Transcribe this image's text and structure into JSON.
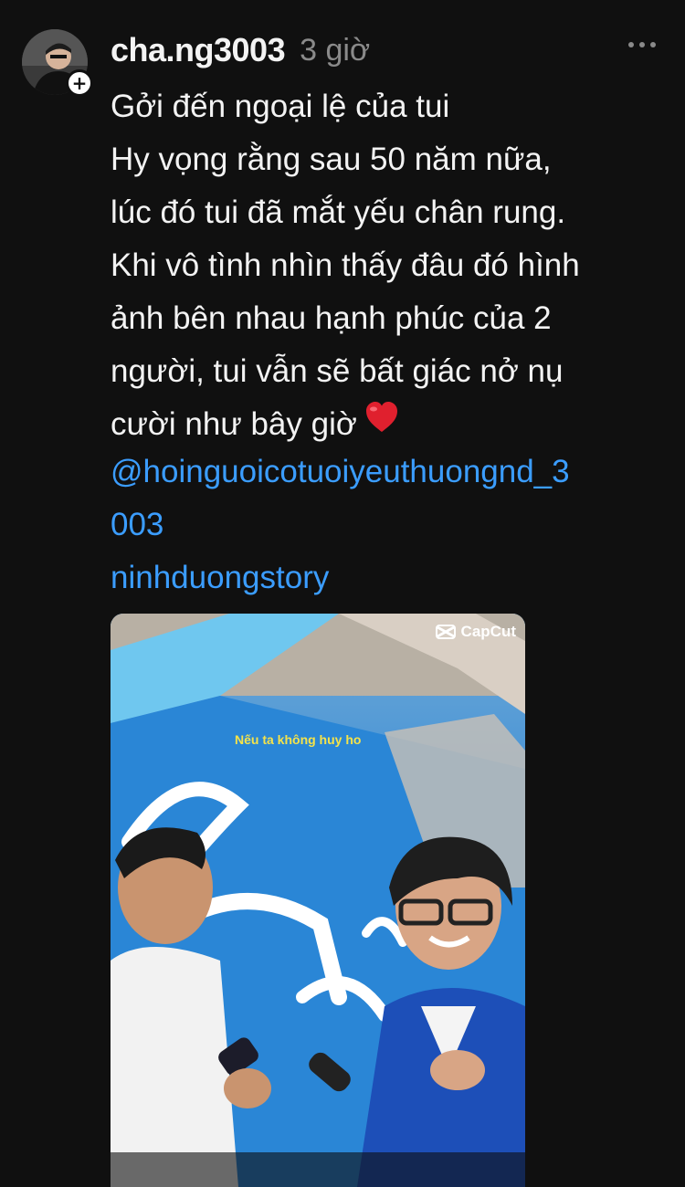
{
  "post": {
    "username": "cha.ng3003",
    "time": "3 giờ",
    "avatar": {
      "icon": "profile-photo",
      "badge": "+"
    },
    "more_icon": "more-dots-icon",
    "text_lines": [
      "Gởi đến ngoại lệ của tui",
      "Hy vọng rằng sau 50 năm nữa,",
      "lúc đó tui đã mắt yếu chân rung.",
      "Khi vô tình nhìn thấy đâu đó hình",
      "ảnh bên nhau hạnh phúc của 2",
      "người, tui vẫn sẽ bất giác nở nụ",
      "cười như bây giờ"
    ],
    "heart_icon": "red-heart-emoji",
    "links": {
      "mention_line1": "@hoinguoicotuoiyeuthuongnd_3",
      "mention_line2": "003",
      "tag": "ninhduongstory"
    },
    "media": {
      "watermark": "CapCut",
      "subtitle": "Nếu ta không huy ho"
    }
  },
  "colors": {
    "background": "#101010",
    "text": "#f3f3f3",
    "muted": "#8a8a8a",
    "link": "#3b9dff",
    "heart": "#e0202e"
  }
}
